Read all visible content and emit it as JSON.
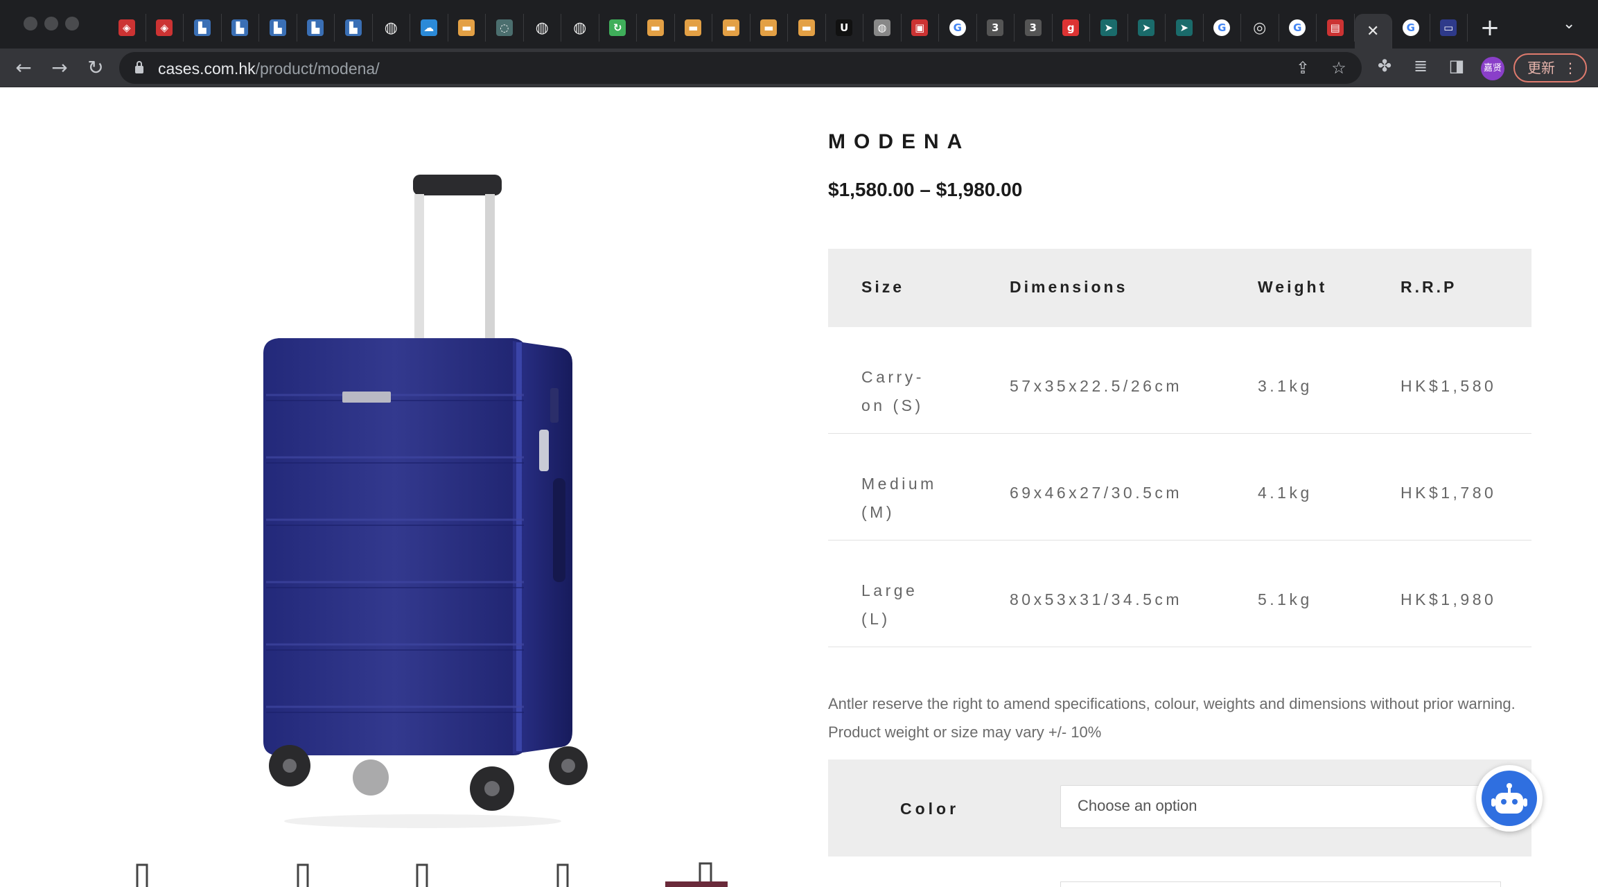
{
  "browser": {
    "url_host": "cases.com.hk",
    "url_path": "/product/modena/",
    "update_label": "更新",
    "profile_label": "嘉贤",
    "close_tab_glyph": "✕",
    "new_tab_glyph": "+",
    "tab_icons": [
      "red-diamond-icon",
      "red-diamond-icon",
      "blue-tile-icon",
      "blue-tile-icon",
      "blue-tile-icon",
      "blue-tile-icon",
      "blue-tile-icon",
      "globe-icon",
      "cloud-icon",
      "ucl-icon",
      "gray-c-icon",
      "globe-icon",
      "globe-icon",
      "green-refresh-icon",
      "ucl-icon",
      "ucl-icon",
      "ucl-icon",
      "ucl-icon",
      "ucl-icon",
      "u-icon",
      "gray-globe-icon",
      "red-box-icon",
      "google-icon",
      "three-icon",
      "three-icon",
      "g-red-icon",
      "teal-arrow-icon",
      "teal-arrow-icon",
      "teal-arrow-icon",
      "google-icon",
      "chrome-icon",
      "google-icon",
      "red-doc-icon",
      "close-icon",
      "google-icon",
      "briefcase-icon"
    ]
  },
  "product": {
    "title": "MODENA",
    "price": "$1,580.00 – $1,980.00",
    "spec_headers": {
      "size": "Size",
      "dimensions": "Dimensions",
      "weight": "Weight",
      "rrp": "R.R.P"
    },
    "specs": [
      {
        "size_line1": "Carry-",
        "size_line2": "on (S)",
        "dimensions": "57x35x22.5/26cm",
        "weight": "3.1kg",
        "rrp": "HK$1,580"
      },
      {
        "size_line1": "Medium",
        "size_line2": "(M)",
        "dimensions": "69x46x27/30.5cm",
        "weight": "4.1kg",
        "rrp": "HK$1,780"
      },
      {
        "size_line1": "Large",
        "size_line2": "(L)",
        "dimensions": "80x53x31/34.5cm",
        "weight": "5.1kg",
        "rrp": "HK$1,980"
      }
    ],
    "disclaimer": "Antler reserve the right to amend specifications, colour, weights and dimensions without prior warning. Product weight or size may vary +/- 10%",
    "color_label": "Color",
    "color_placeholder": "Choose an option",
    "image_color": "#2e3580"
  }
}
